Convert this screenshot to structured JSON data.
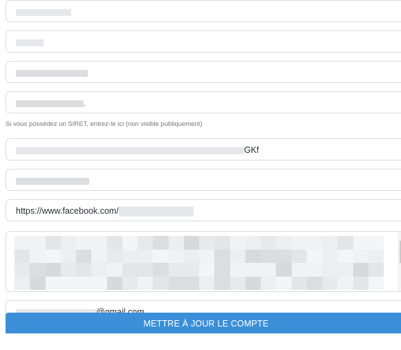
{
  "form": {
    "fields": [
      {
        "value": ""
      },
      {
        "value": ""
      },
      {
        "value": "."
      },
      {
        "value": "."
      }
    ],
    "siret_hint": "Si vous possédez un SIRET, entrez-le ici (non visible publiquement)",
    "siret_value_suffix": "GKf",
    "field_6_value": "",
    "facebook_prefix": "https://www.facebook.com/",
    "description_value": "",
    "email_suffix": "@gmail.com",
    "submit_label": "METTRE À JOUR LE COMPTE"
  }
}
